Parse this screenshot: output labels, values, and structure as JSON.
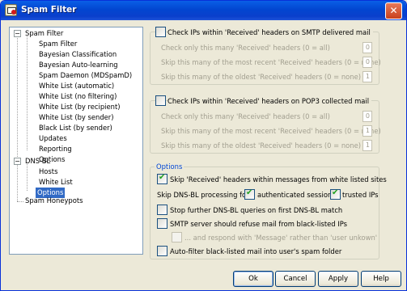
{
  "window": {
    "title": "Spam Filter",
    "close_glyph": "✕"
  },
  "tree": {
    "root1": "Spam Filter",
    "items1": [
      "Spam Filter",
      "Bayesian Classification",
      "Bayesian Auto-learning",
      "Spam Daemon (MDSpamD)",
      "White List (automatic)",
      "White List (no filtering)",
      "White List (by recipient)",
      "White List (by sender)",
      "Black List (by sender)",
      "Updates",
      "Reporting",
      "Options"
    ],
    "root2": "DNS-BL",
    "items2": [
      "Hosts",
      "White List",
      "Options"
    ],
    "root3": "Spam Honeypots",
    "expander_minus": "−"
  },
  "smtp": {
    "check_label": "Check IPs within 'Received' headers on SMTP delivered mail",
    "row1": "Check only this many 'Received' headers (0 = all)",
    "row2": "Skip this many of the most recent 'Received' headers (0 = none)",
    "row3": "Skip this many of the oldest 'Received' headers (0 = none)",
    "v1": "0",
    "v2": "0",
    "v3": "1"
  },
  "pop3": {
    "check_label": "Check IPs within 'Received' headers on POP3 collected mail",
    "row1": "Check only this many 'Received' headers (0 = all)",
    "row2": "Skip this many of the most recent 'Received' headers (0 = none)",
    "row3": "Skip this many of the oldest 'Received' headers (0 = none)",
    "v1": "0",
    "v2": "1",
    "v3": "1"
  },
  "options": {
    "legend": "Options",
    "skip_whitelisted": "Skip 'Received' headers within messages from white listed sites",
    "skip_dnsbl_for": "Skip DNS-BL processing for",
    "authenticated": "authenticated sessions",
    "trusted": "trusted IPs",
    "stop_further": "Stop further DNS-BL queries on first DNS-BL match",
    "smtp_refuse": "SMTP server should refuse mail from black-listed IPs",
    "respond_message": "... and respond with 'Message' rather than 'user unkown'",
    "auto_filter": "Auto-filter black-listed mail into user's spam folder"
  },
  "buttons": {
    "ok": "Ok",
    "cancel": "Cancel",
    "apply": "Apply",
    "help": "Help"
  }
}
